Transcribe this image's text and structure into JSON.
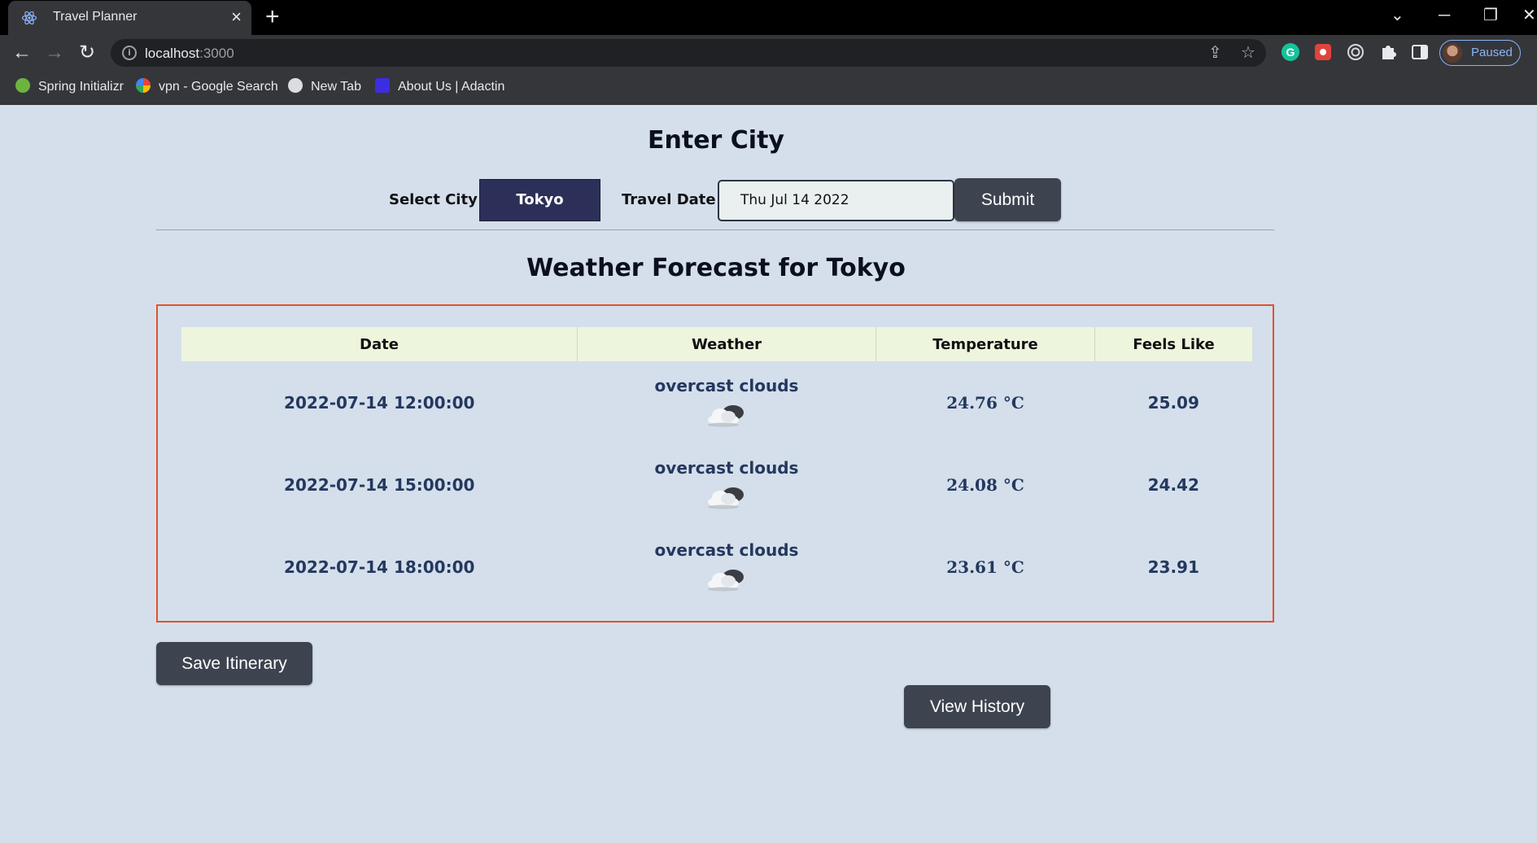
{
  "browser": {
    "tab_title": "Travel Planner",
    "new_tab_symbol": "+",
    "url_host": "localhost",
    "url_rest": ":3000",
    "profile_status": "Paused",
    "bookmarks": [
      "Spring Initializr",
      "vpn - Google Search",
      "New Tab",
      "About Us | Adactin"
    ]
  },
  "page": {
    "heading": "Enter City",
    "select_city_label": "Select City",
    "selected_city": "Tokyo",
    "travel_date_label": "Travel Date",
    "travel_date_value": "Thu Jul 14 2022",
    "submit_label": "Submit",
    "forecast_heading": "Weather Forecast for Tokyo",
    "save_label": "Save Itinerary",
    "history_label": "View History"
  },
  "forecast": {
    "columns": [
      "Date",
      "Weather",
      "Temperature",
      "Feels Like"
    ],
    "rows": [
      {
        "date": "2022-07-14 12:00:00",
        "weather": "overcast clouds",
        "icon": "cloud-icon",
        "temperature": "24.76 °C",
        "feels_like": "25.09"
      },
      {
        "date": "2022-07-14 15:00:00",
        "weather": "overcast clouds",
        "icon": "cloud-icon",
        "temperature": "24.08 °C",
        "feels_like": "24.42"
      },
      {
        "date": "2022-07-14 18:00:00",
        "weather": "overcast clouds",
        "icon": "cloud-icon",
        "temperature": "23.61 °C",
        "feels_like": "23.91"
      }
    ]
  },
  "colors": {
    "page_background": "#d4dfeb",
    "city_button": "#2c3058",
    "dark_button": "#3d4450",
    "forecast_border": "#e6502a",
    "table_header": "#eef5dd",
    "row_text": "#24385f"
  }
}
